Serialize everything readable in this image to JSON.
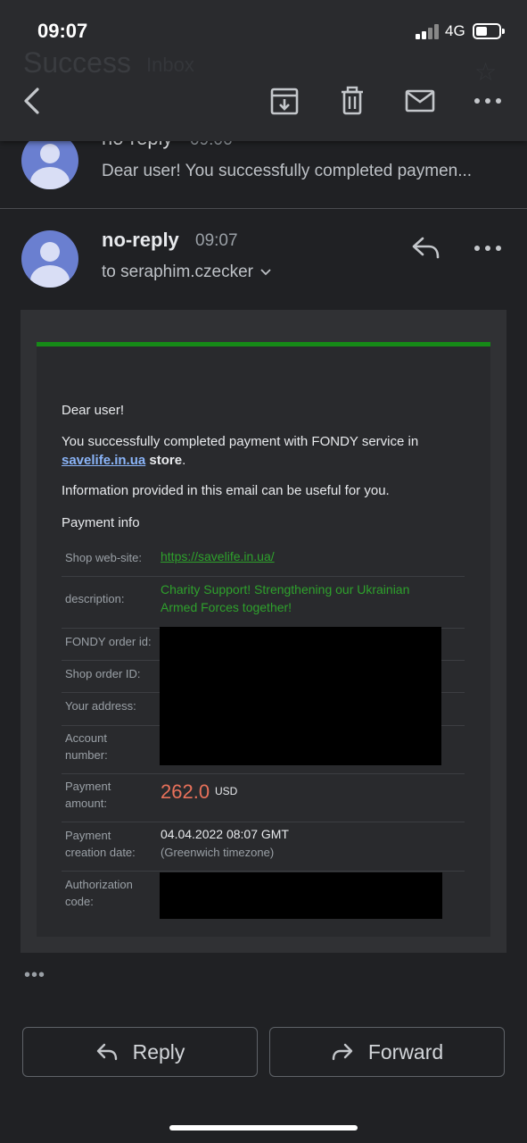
{
  "status_bar": {
    "time": "09:07",
    "network": "4G"
  },
  "header": {
    "subject_ghost": "Success",
    "label_ghost": "Inbox",
    "actions": [
      "back",
      "archive",
      "delete",
      "mark-unread",
      "more"
    ]
  },
  "thread": {
    "collapsed": {
      "sender": "no-reply",
      "time": "09:06",
      "snippet": "Dear user! You successfully completed paymen..."
    },
    "expanded": {
      "sender": "no-reply",
      "time": "09:07",
      "to_line": "to seraphim.czecker"
    }
  },
  "email": {
    "greeting": "Dear user!",
    "line1_prefix": "You successfully completed payment with FONDY service in",
    "store_link": "savelife.in.ua",
    "store_suffix": "store",
    "line2": "Information provided in this email can be useful for you.",
    "payment_info_title": "Payment info",
    "rows": {
      "shop_site_label": "Shop web-site:",
      "shop_site_value": "https://savelife.in.ua/",
      "description_label": "description:",
      "description_value_1": "Charity Support! Strengthening our Ukrainian",
      "description_value_2": "Armed Forces together!",
      "fondy_order_label": "FONDY order id:",
      "shop_order_label": "Shop order ID:",
      "address_label": "Your address:",
      "account_label_1": "Account",
      "account_label_2": "number:",
      "amount_label_1": "Payment",
      "amount_label_2": "amount:",
      "amount_value": "262.0",
      "amount_currency": "USD",
      "creation_label_1": "Payment",
      "creation_label_2": "creation date:",
      "creation_value": "04.04.2022 08:07 GMT",
      "creation_note": "(Greenwich timezone)",
      "auth_label_1": "Authorization",
      "auth_label_2": "code:"
    }
  },
  "more_dots": "•••",
  "footer": {
    "reply_label": "Reply",
    "forward_label": "Forward"
  },
  "colors": {
    "accent_bar": "#168a17",
    "amount": "#e8715a",
    "link": "#8ab4f8"
  }
}
